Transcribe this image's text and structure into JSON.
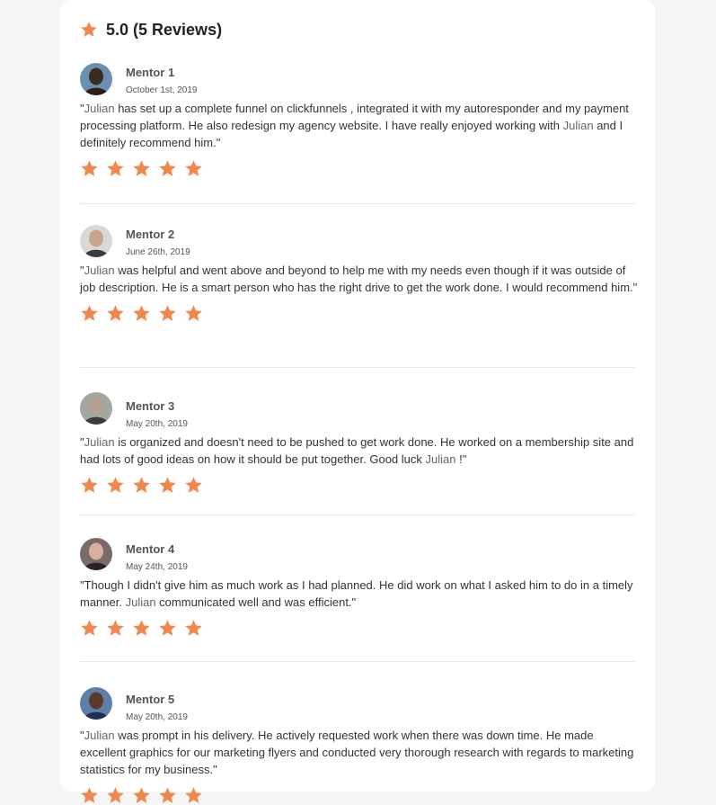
{
  "summary": {
    "rating_text": "5.0 (5 Reviews)",
    "star_color": "#f0874d"
  },
  "reviews": [
    {
      "name": "Mentor 1",
      "date": "October 1st, 2019",
      "text_parts": [
        "\"",
        "Julian",
        "  has set up a complete funnel on clickfunnels , integrated it with my autoresponder and my payment processing platform. He also redesign my agency website. I have really enjoyed working with ",
        "Julian",
        "  and I definitely recommend him.\""
      ],
      "stars": 5
    },
    {
      "name": "Mentor 2",
      "date": "June 26th, 2019",
      "text_parts": [
        "\"",
        "Julian",
        "  was helpful and went above and beyond to help me with my needs even though if it was outside of job description. He is a smart person who has the right drive to get the work done. I would recommend him.\""
      ],
      "stars": 5
    },
    {
      "name": "Mentor 3",
      "date": "May 20th, 2019",
      "text_parts": [
        "\"",
        "Julian",
        "  is organized and doesn't need to be pushed to get work done. He worked on a membership site and had lots of good ideas on how it should be put together. Good luck ",
        "Julian",
        " !\""
      ],
      "stars": 5
    },
    {
      "name": "Mentor 4",
      "date": "May 24th, 2019",
      "text_parts": [
        "\"Though I didn't give him as much work as I had planned. He did work on what I asked him to do in a timely manner. ",
        "Julian",
        "  communicated well and was efficient.\""
      ],
      "stars": 5
    },
    {
      "name": "Mentor 5",
      "date": "May 20th, 2019",
      "text_parts": [
        "\"",
        "Julian",
        "  was prompt in his delivery. He actively requested work when there was down time. He made excellent graphics for our marketing flyers and conducted very thorough research with regards to marketing statistics for my business.\""
      ],
      "stars": 5
    }
  ]
}
